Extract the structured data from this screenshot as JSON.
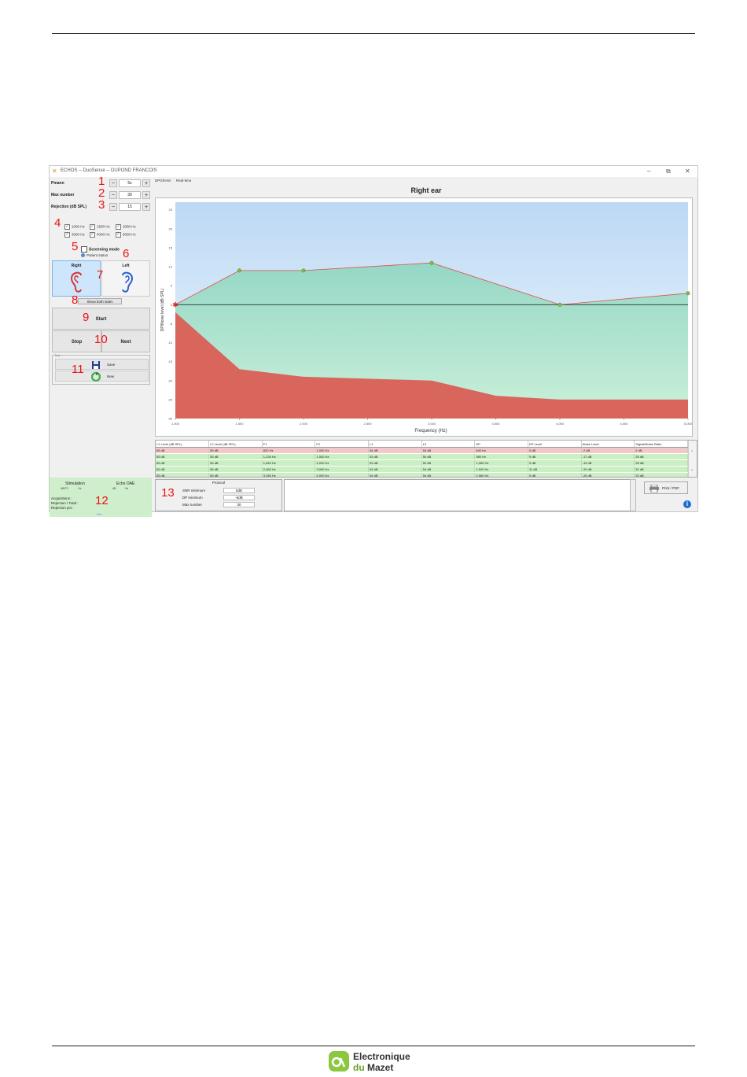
{
  "window": {
    "title": "ECHOS -- DuoSense -- DUPOND FRANCOIS",
    "controls": {
      "minimize": "–",
      "maximize": "⧉",
      "close": "✕"
    }
  },
  "params": [
    {
      "label": "Pmann",
      "value": "5s",
      "annotation": "1"
    },
    {
      "label": "Max number",
      "value": "30",
      "annotation": "2"
    },
    {
      "label": "Rejection (dB SPL)",
      "value": "15",
      "annotation": "3"
    }
  ],
  "param_buttons": {
    "minus": "−",
    "plus": "+"
  },
  "frequencies": [
    {
      "label": "1000 Hz",
      "checked": true
    },
    {
      "label": "1500 Hz",
      "checked": true
    },
    {
      "label": "2000 Hz",
      "checked": true
    },
    {
      "label": "3000 Hz",
      "checked": true
    },
    {
      "label": "4000 Hz",
      "checked": true
    },
    {
      "label": "5000 Hz",
      "checked": true
    }
  ],
  "screening_mode": "Screening mode",
  "pass_status": "Patient status",
  "ears": {
    "right": "Right",
    "left": "Left"
  },
  "show_both": "Show both sides",
  "buttons": {
    "start": "Start",
    "stop": "Stop",
    "next": "Next"
  },
  "test_box": {
    "caption": "Test",
    "save": "Save",
    "new": "New"
  },
  "stimulation": {
    "title_left": "Stimulation",
    "title_right": "Echo OAE",
    "sub_left": "dB/FS",
    "sub_left2": "Hz",
    "sub_right": "dB",
    "sub_right2": "Hz",
    "acquisitions": "Acquisitions :",
    "rejection_total": "Rejection / Total :",
    "rejection_pct": "Rejection pct :",
    "percent": "0%"
  },
  "annotations": {
    "freq": "4",
    "screening": "5",
    "status": "6",
    "ears": "7",
    "show_both": "8",
    "start": "9",
    "stopnext": "10",
    "test": "11",
    "stim": "12",
    "protocol": "13"
  },
  "tabs": [
    "DPGRAM",
    "Real-time"
  ],
  "chart_title": "Right ear",
  "chart_data": {
    "type": "area",
    "xlabel": "Frequency (Hz)",
    "ylabel": "DP/Noise level (dB SPL)",
    "xlim": [
      1000,
      5000
    ],
    "ylim": [
      -30,
      27
    ],
    "xticks": [
      1000,
      1500,
      2000,
      2500,
      3000,
      3500,
      4000,
      4500,
      5000
    ],
    "xtick_labels": [
      "1,000",
      "1,500",
      "2,000",
      "2,500",
      "3,000",
      "3,500",
      "4,000",
      "4,500",
      "5,000"
    ],
    "yticks": [
      -30,
      -25,
      -20,
      -15,
      -10,
      -5,
      0,
      5,
      10,
      15,
      20,
      25
    ],
    "series": [
      {
        "name": "DP Level",
        "color": "#e05050",
        "x": [
          1000,
          1500,
          2000,
          3000,
          4000,
          5000
        ],
        "y": [
          0,
          9,
          9,
          11,
          0,
          3
        ]
      },
      {
        "name": "Noise Level",
        "color": "#d9665c",
        "x": [
          1000,
          1500,
          2000,
          3000,
          3500,
          4000,
          5000
        ],
        "y": [
          -2,
          -17,
          -19,
          -20,
          -24,
          -25,
          -25
        ]
      }
    ],
    "colors": {
      "area_dp": "#a8e0c9",
      "area_noise": "#d8665c",
      "bg_top": "#bcd8f5"
    }
  },
  "table": {
    "headers": [
      "L1 Level (dB SPL)",
      "L2 Level (dB SPL)",
      "F1",
      "F2",
      "L1",
      "L2",
      "DP",
      "DP Level",
      "Noise Level",
      "Signal/Noise Ratio"
    ],
    "rows": [
      {
        "state": "sel",
        "cells": [
          "65 dB",
          "55 dB",
          "820 Hz",
          "1,000 Hz",
          "64 dB",
          "54 dB",
          "640 Hz",
          "0 dB",
          "-2 dB",
          "2 dB"
        ]
      },
      {
        "state": "ok",
        "cells": [
          "65 dB",
          "55 dB",
          "1,230 Hz",
          "1,500 Hz",
          "63 dB",
          "54 dB",
          "960 Hz",
          "9 dB",
          "-17 dB",
          "26 dB"
        ]
      },
      {
        "state": "ok",
        "cells": [
          "65 dB",
          "55 dB",
          "1,640 Hz",
          "2,000 Hz",
          "63 dB",
          "53 dB",
          "1,280 Hz",
          "9 dB",
          "-19 dB",
          "28 dB"
        ]
      },
      {
        "state": "ok",
        "cells": [
          "65 dB",
          "55 dB",
          "2,460 Hz",
          "3,000 Hz",
          "63 dB",
          "54 dB",
          "1,920 Hz",
          "11 dB",
          "-20 dB",
          "31 dB"
        ]
      },
      {
        "state": "ok",
        "cells": [
          "65 dB",
          "55 dB",
          "3,280 Hz",
          "4,000 Hz",
          "64 dB",
          "54 dB",
          "2,560 Hz",
          "0 dB",
          "-25 dB",
          "25 dB"
        ]
      }
    ]
  },
  "protocol": {
    "caption": "Protocol",
    "rows": [
      {
        "label": "SNR minimum",
        "value": "6dB"
      },
      {
        "label": "DP minimum",
        "value": "-5dB"
      },
      {
        "label": "Max number",
        "value": "30"
      }
    ]
  },
  "print_button": "Print / PDF",
  "footer": {
    "line1": "Electronique",
    "line2a": "du",
    "line2b": "Mazet"
  }
}
